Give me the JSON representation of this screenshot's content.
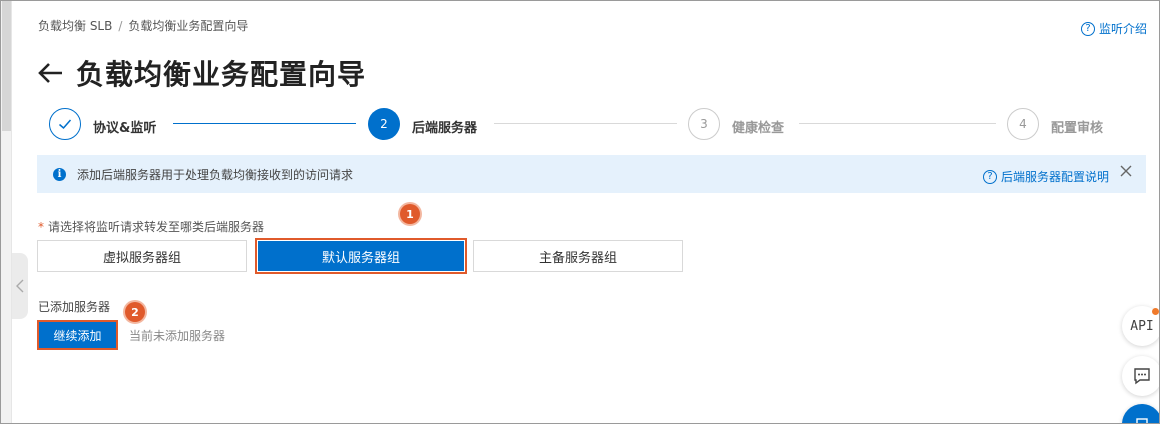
{
  "breadcrumb": {
    "items": [
      "负载均衡 SLB",
      "负载均衡业务配置向导"
    ],
    "separator": "/"
  },
  "header": {
    "title": "负载均衡业务配置向导",
    "help_link": "监听介绍",
    "back_icon": "arrow-left-icon"
  },
  "steps": [
    {
      "number": "",
      "label": "协议&监听",
      "state": "done"
    },
    {
      "number": "2",
      "label": "后端服务器",
      "state": "current"
    },
    {
      "number": "3",
      "label": "健康检查",
      "state": "todo"
    },
    {
      "number": "4",
      "label": "配置审核",
      "state": "todo"
    }
  ],
  "alert": {
    "text": "添加后端服务器用于处理负载均衡接收到的访问请求",
    "help_link": "后端服务器配置说明"
  },
  "server_group": {
    "required_mark": "*",
    "label": "请选择将监听请求转发至哪类后端服务器",
    "options": [
      "虚拟服务器组",
      "默认服务器组",
      "主备服务器组"
    ],
    "selected": "默认服务器组"
  },
  "added_servers": {
    "label": "已添加服务器",
    "continue_button": "继续添加",
    "empty_text": "当前未添加服务器"
  },
  "markers": [
    "1",
    "2"
  ],
  "float_buttons": {
    "api_label": "API"
  },
  "colors": {
    "primary": "#0070cc",
    "highlight": "#e05a2b",
    "alert_bg": "#e5f1fc"
  }
}
